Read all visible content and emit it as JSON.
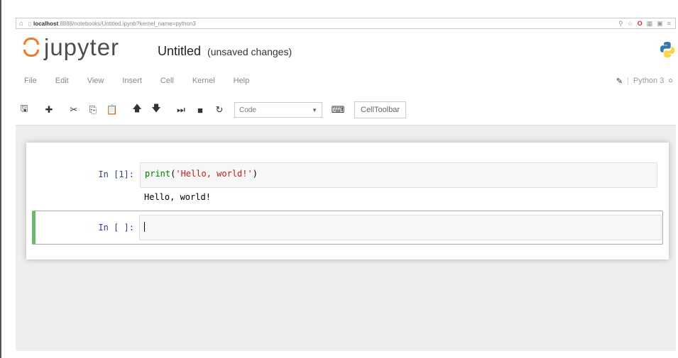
{
  "browser": {
    "url_host": "localhost",
    "url_rest": ":8888/notebooks/Untitled.ipynb?kernel_name=python3",
    "home_icon": "home-icon",
    "lock_icon": "page-icon"
  },
  "header": {
    "logo_text": "jupyter",
    "title": "Untitled",
    "status": "(unsaved changes)"
  },
  "menu": {
    "items": [
      "File",
      "Edit",
      "View",
      "Insert",
      "Cell",
      "Kernel",
      "Help"
    ],
    "kernel_name": "Python 3"
  },
  "toolbar": {
    "cell_type": "Code",
    "celltoolbar_label": "CellToolbar"
  },
  "cells": [
    {
      "prompt": "In [1]:",
      "code_fn": "print",
      "code_open": "(",
      "code_str": "'Hello, world!'",
      "code_close": ")",
      "output": "Hello, world!"
    },
    {
      "prompt": "In [ ]:"
    }
  ],
  "colors": {
    "accent_orange": "#f37726",
    "selected_cell_border": "#66bb6a",
    "prompt_blue": "#303f9f"
  }
}
